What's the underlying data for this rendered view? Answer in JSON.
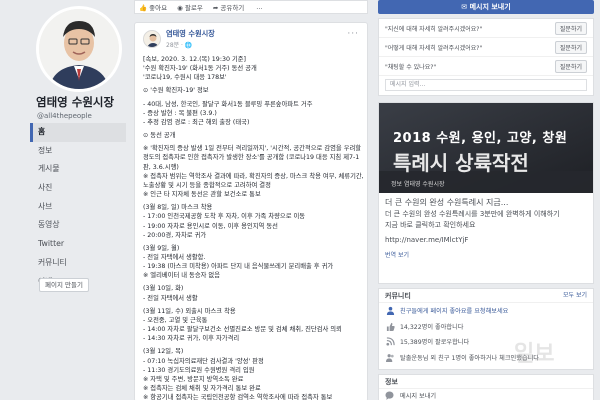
{
  "page": {
    "name": "염태영 수원시장",
    "handle": "@all4thepeople"
  },
  "left_nav": {
    "items": [
      "홈",
      "정보",
      "게시물",
      "사진",
      "사브",
      "동영상",
      "Twitter",
      "커뮤니티",
      "이벤트"
    ],
    "active_index": 0,
    "create_page_label": "페이지 만들기"
  },
  "top_actions": {
    "like": "좋아요",
    "follow": "팔로우",
    "share": "공유하기",
    "more": "..."
  },
  "post": {
    "author": "염태영 수원시장",
    "meta": "28분 · 🌐",
    "lines": [
      "[속보, 2020. 3. 12.(목) 19:30 기준]",
      "'수원 확진자-19' (화서1동 거주) 동선 공개",
      "'코로나19, 수원시 대응 178보'",
      "",
      "⊙ '수원 확진자-19' 정보",
      "",
      "- 40대, 남성, 한국인, 팔달구 화서1동 블루밍 푸른숲아파트 거주",
      "- 증상 발현 : 목 불편 (3.9.)",
      "- 추정 감염 경로 : 최근 해외 출장 (태국)",
      "",
      "⊙ 동선 공개",
      "",
      "※ '확진자의 증상 발생 1일 전부터 격리일까지', '시간적, 공간적으로 감염을 우려할 정도의 접촉자로 인한 접촉자가 발생한 장소'를 공개함 (코로나19 대응 지침 제7-1판, 3.6.시행)",
      "※ 접촉자 범위는 역학조사 결과에 따라, 확진자의 증상, 마스크 착용 여부, 체류기간, 노출상황 및 시기 등을 종합적으로 고려하여 결정",
      "※ 인근 타 지자체 동선은 관할 보건소로 통보",
      "",
      "(3월 8일, 일) 마스크 착용",
      "- 17:00 인천국제공항 도착 후 자차, 이후 가족 차량으로 이동",
      "- 19:00 자차로 용인시로 이동, 이후 용인지역 동선",
      "- 20:00경, 자차로 귀가",
      "",
      "(3월 9일, 월)",
      "- 전일 자택에서 생활함.",
      "- 19:38 (마스크 미착용) 아파트 단지 내 음식물쓰레기 분리배출 후 귀가",
      "※ 엘리베이터 내 동승자 없음",
      "",
      "(3월 10일, 화)",
      "- 전일 자택에서 생활",
      "",
      "(3월 11일, 수) 외출시 마스크 착용",
      "- 오전중, 고열 및 근육통",
      "- 14:00 자차로 팔달구보건소 선별진료소 방문 및 검체 채취, 진단검사 의뢰",
      "- 14:30 자차로 귀가, 이후 자가격리",
      "",
      "(3월 12일, 목)",
      "- 07:10 녹십자의료재단 검사결과 '양성' 판정",
      "- 11:30 경기도의료원 수원병원 격리 입원",
      "※ 자택 및 주변, 방문지 방역소독 완료",
      "※ 접촉자는 검체 채취 및 자가격리 통보 완료",
      "※ 항공기내 접촉자는 국립인천공항 검역소 역학조사에 따라 접촉자 통보"
    ]
  },
  "right": {
    "message_button": "메시지 보내기",
    "qa": [
      {
        "q": "\"지신에 대해 자세히 알려주시겠어요?\"",
        "btn": "질문하기"
      },
      {
        "q": "\"어떻게 대해 자세히 알려주시겠어요?\"",
        "btn": "질문하기"
      },
      {
        "q": "\"채팅할 수 있나요?\"",
        "btn": "질문하기"
      }
    ],
    "qa_input_placeholder": "메시지 입력...",
    "ad": {
      "image_line1": "2018 수원, 용인, 고양, 창원",
      "image_line2": "특례시 상륙작전",
      "image_caption": "정보  염태영 수원시장",
      "text_line1": "더 큰 수원의 완성 수원특례시 지금...",
      "text_line2": "더 큰 수원의 완성 수원특례시를 3분만에 완벽하게 이해하기",
      "text_line3": "지금 바로 클릭하고 확인하세요",
      "link": "http://naver.me/IMlctYjF",
      "translate": "번역 보기"
    },
    "community": {
      "title": "커뮤니티",
      "more": "모두 보기",
      "rows": [
        {
          "icon": "invite-friends-icon",
          "text": "친구들에게 페이지 좋아요를 요청해보세요"
        },
        {
          "icon": "like-icon",
          "text": "14,322명이 좋아합니다"
        },
        {
          "icon": "follow-icon",
          "text": "15,389명이 팔로우합니다"
        },
        {
          "icon": "friends-icon",
          "text": "탈출운동님 외 친구 1명이 좋아하거나 체크인했습니다"
        }
      ]
    },
    "info": {
      "title": "정보",
      "rows": [
        {
          "icon": "messenger-icon",
          "text": "메시지 보내기"
        }
      ]
    }
  },
  "watermark": "일보",
  "colors": {
    "facebook_blue": "#4267b2",
    "link_blue": "#365899",
    "bg": "#e9ebee",
    "ad_dark": "#2a2d33"
  }
}
